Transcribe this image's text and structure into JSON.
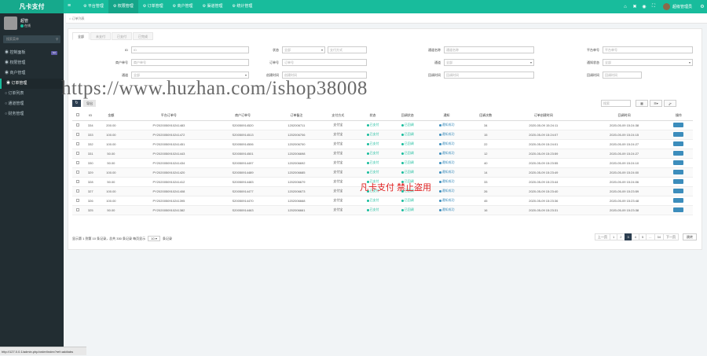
{
  "app": {
    "logo": "凡卡支付"
  },
  "topnav": [
    "平台管理",
    "权限管理",
    "订单管理",
    "商户管理",
    "渠道管理",
    "统计管理"
  ],
  "topright": {
    "user_name": "超级管理员"
  },
  "sidebar": {
    "user_name": "超管",
    "user_status": "在线",
    "search_placeholder": "搜索菜单",
    "items": [
      {
        "label": "控制面板",
        "badge": "hot"
      },
      {
        "label": "权限管理"
      },
      {
        "label": "商户管理"
      },
      {
        "label": "订单管理"
      },
      {
        "label": "订单列表"
      },
      {
        "label": "通道管理"
      },
      {
        "label": "财务管理"
      }
    ]
  },
  "breadcrumb": "订单列表",
  "tabs": [
    "全部",
    "未支付",
    "已支付",
    "已完成"
  ],
  "filters": [
    {
      "label": "ID",
      "value": "ID"
    },
    {
      "label": "状态",
      "value": "全部"
    },
    {
      "label": "支付方式",
      "value": "支付方式"
    },
    {
      "label": "通道名称",
      "value": "通道名称"
    },
    {
      "label": "平台单号",
      "value": "平台单号"
    },
    {
      "label": "商户单号",
      "value": "商户单号"
    },
    {
      "label": "通道",
      "value": "全部"
    },
    {
      "label": "通知状态",
      "value": "全部"
    },
    {
      "label": "通道",
      "value": "全部"
    },
    {
      "label": "订单号",
      "value": "订单号"
    },
    {
      "label": "创建时间",
      "value": "创建时间"
    },
    {
      "label": "回调时间",
      "value": "回调时间"
    }
  ],
  "toolbar": {
    "export_label": "导出",
    "search_placeholder": "搜索"
  },
  "table": {
    "headers": [
      "ID",
      "金额",
      "平台订单号",
      "商户订单号",
      "订单备注",
      "支付方式",
      "状态",
      "回调状态",
      "通知",
      "回调次数",
      "订单创建时间",
      "回调时间",
      "操作"
    ],
    "rows": [
      [
        "334",
        "200.00",
        "PY2020050910241483",
        "S20050914520",
        "1202006711",
        "支付宝",
        "已支付",
        "已回调",
        "通知成功",
        "34",
        "2020-05-09 15:24:11",
        "2020-05-09 15:24:38"
      ],
      [
        "333",
        "100.00",
        "PY2020050910241472",
        "S20050914513",
        "1202006706",
        "支付宝",
        "已支付",
        "已回调",
        "通知成功",
        "15",
        "2020-05-09 15:24:07",
        "2020-05-09 15:24:15"
      ],
      [
        "332",
        "100.00",
        "PY2020050910241451",
        "S20050914506",
        "1202006700",
        "支付宝",
        "已支付",
        "已回调",
        "通知成功",
        "22",
        "2020-05-09 15:24:01",
        "2020-05-09 15:24:27"
      ],
      [
        "331",
        "50.00",
        "PY2020050910241443",
        "S20050914501",
        "1202006698",
        "支付宝",
        "已支付",
        "已回调",
        "通知成功",
        "12",
        "2020-05-09 15:23:59",
        "2020-05-09 15:24:27"
      ],
      [
        "330",
        "50.00",
        "PY2020050910241434",
        "S20050914497",
        "1202006692",
        "支付宝",
        "已支付",
        "已回调",
        "通知成功",
        "40",
        "2020-05-09 15:23:55",
        "2020-05-09 15:24:10"
      ],
      [
        "329",
        "100.00",
        "PY2020050910241420",
        "S20050914489",
        "1202006685",
        "支付宝",
        "已支付",
        "已回调",
        "通知成功",
        "14",
        "2020-05-09 15:23:49",
        "2020-05-09 15:24:00"
      ],
      [
        "328",
        "50.00",
        "PY2020050910241412",
        "S20050914483",
        "1202006679",
        "支付宝",
        "已支付",
        "已回调",
        "通知成功",
        "33",
        "2020-05-09 15:23:44",
        "2020-05-09 15:24:06"
      ],
      [
        "327",
        "100.00",
        "PY2020050910241408",
        "S20050914477",
        "1202006673",
        "支付宝",
        "已支付",
        "已回调",
        "通知成功",
        "26",
        "2020-05-09 15:23:40",
        "2020-05-09 15:23:59"
      ],
      [
        "326",
        "100.00",
        "PY2020050910241395",
        "S20050914470",
        "1202006668",
        "支付宝",
        "已支付",
        "已回调",
        "通知成功",
        "45",
        "2020-05-09 15:23:36",
        "2020-05-09 15:23:48"
      ],
      [
        "325",
        "50.00",
        "PY2020050910241382",
        "S20050914463",
        "1202006661",
        "支付宝",
        "已支付",
        "已回调",
        "通知成功",
        "16",
        "2020-05-09 15:23:31",
        "2020-05-09 15:23:38"
      ]
    ]
  },
  "footer": {
    "summary": "显示第 1 到第 10 条记录，总共 330 条记录 每页显示",
    "per_page": "10",
    "per_page_suffix": "条记录"
  },
  "pager": [
    "上一页",
    "1",
    "2",
    "3",
    "4",
    "5",
    "...",
    "34",
    "下一页"
  ],
  "pager_active": "3",
  "pager_go": "跳转",
  "watermark": "https://www.huzhan.com/ishop38008",
  "stamp": "凡卡支付 禁止盗用",
  "status_url": "http://127.0.0.1/admin.php/order/index?ref=addtabs",
  "colors": {
    "accent": "#18bc9c",
    "sidebar": "#222d32",
    "paid": "#18bc9c",
    "notify": "#3c8dbc"
  }
}
